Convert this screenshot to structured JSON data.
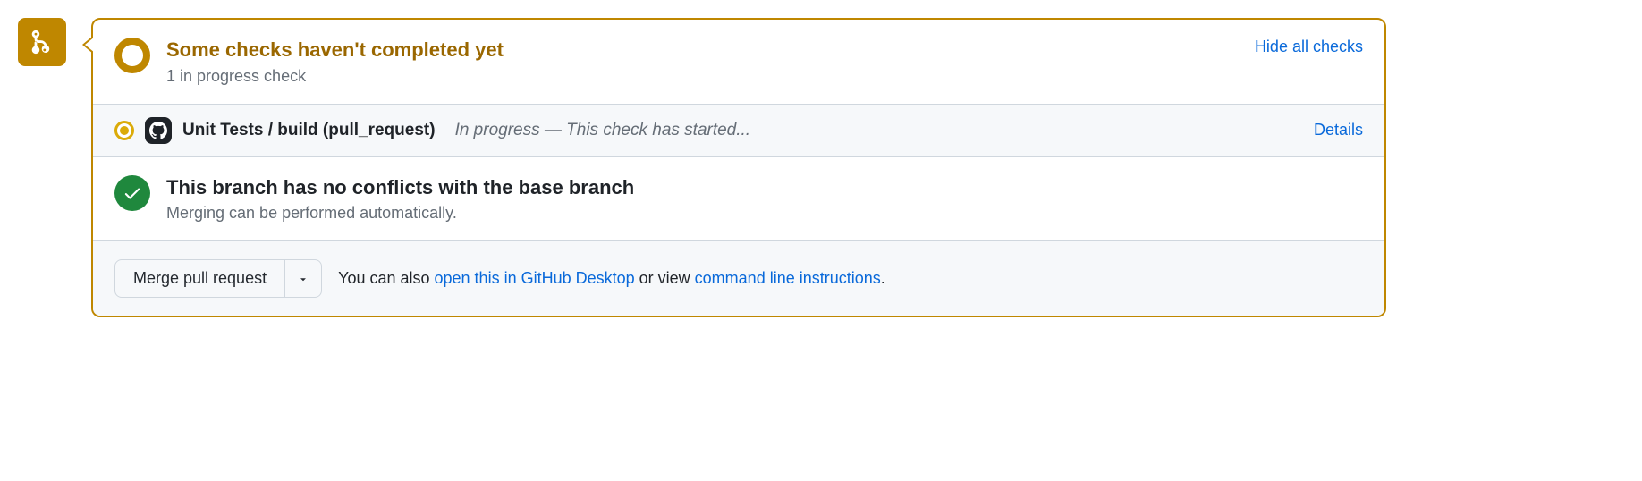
{
  "status": {
    "title": "Some checks haven't completed yet",
    "subtitle": "1 in progress check",
    "toggle": "Hide all checks"
  },
  "checks": [
    {
      "name": "Unit Tests / build (pull_request)",
      "status": "In progress — This check has started...",
      "details_label": "Details"
    }
  ],
  "mergeability": {
    "title": "This branch has no conflicts with the base branch",
    "subtitle": "Merging can be performed automatically."
  },
  "footer": {
    "merge_button": "Merge pull request",
    "text_prefix": "You can also ",
    "link_desktop": "open this in GitHub Desktop",
    "text_middle": " or view ",
    "link_cli": "command line instructions",
    "text_suffix": "."
  }
}
